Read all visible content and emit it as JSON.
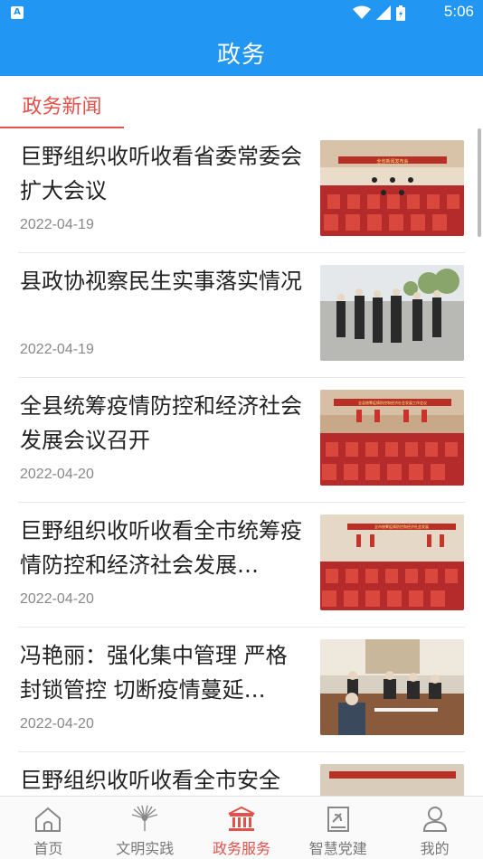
{
  "status_bar": {
    "time": "5:06",
    "app_letter": "A"
  },
  "header": {
    "title": "政务"
  },
  "tabs": [
    {
      "label": "政务新闻",
      "active": true
    }
  ],
  "news": [
    {
      "title": "巨野组织收听收看省委常委会扩大会议",
      "date": "2022-04-19",
      "banner": "全省新闻发布会"
    },
    {
      "title": "县政协视察民生实事落实情况",
      "date": "2022-04-19",
      "banner": ""
    },
    {
      "title": "全县统筹疫情防控和经济社会发展会议召开",
      "date": "2022-04-20",
      "banner": "全县统筹疫情防控和经济社会发展工作会议"
    },
    {
      "title": "巨野组织收听收看全市统筹疫情防控和经济社会发展…",
      "date": "2022-04-20",
      "banner": "全市统筹疫情防控和经济社会发展"
    },
    {
      "title": "冯艳丽：强化集中管理 严格封锁管控 切断疫情蔓延…",
      "date": "2022-04-20",
      "banner": ""
    },
    {
      "title": "巨野组织收听收看全市安全",
      "date": "",
      "banner": ""
    }
  ],
  "bottom_nav": [
    {
      "label": "首页",
      "icon": "home-icon",
      "active": false
    },
    {
      "label": "文明实践",
      "icon": "peacock-icon",
      "active": false
    },
    {
      "label": "政务服务",
      "icon": "government-building-icon",
      "active": true
    },
    {
      "label": "智慧党建",
      "icon": "party-book-icon",
      "active": false
    },
    {
      "label": "我的",
      "icon": "profile-icon",
      "active": false
    }
  ],
  "colors": {
    "primary": "#2196f3",
    "accent": "#e4504a",
    "text": "#222222",
    "muted": "#888888"
  }
}
